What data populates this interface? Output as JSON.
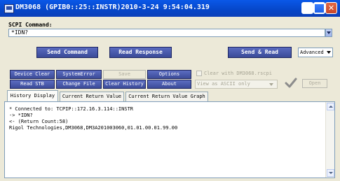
{
  "window": {
    "title": "DM3068 (GPIB0::25::INSTR)2010-3-24 9:54:04.319"
  },
  "scpi": {
    "label": "SCPI Command:",
    "value": "*IDN?"
  },
  "main_buttons": {
    "send_command": "Send Command",
    "read_response": "Read Response",
    "send_read": "Send & Read",
    "advanced": "Advanced"
  },
  "tool_buttons": {
    "device_clear": "Device Clear",
    "system_error": "SystemError",
    "save": "Save",
    "options": "Options",
    "read_stb": "Read STB",
    "change_file": "Change File",
    "clear_history": "Clear History",
    "about": "About",
    "open": "Open"
  },
  "options_area": {
    "clear_checkbox_label": "Clear with DM3068.rscpi",
    "view_select_value": "View as ASCII only"
  },
  "tabs": [
    {
      "label": "History Display",
      "active": true
    },
    {
      "label": "Current Return Value",
      "active": false
    },
    {
      "label": "Current Return Value Graph",
      "active": false
    }
  ],
  "history": {
    "lines": [
      "* Connected to: TCPIP::172.16.3.114::INSTR",
      "-> *IDN?",
      "<- (Return Count:58)",
      "Rigol Technologies,DM3068,DM3A201003060,01.01.00.01.99.00"
    ]
  },
  "colors": {
    "titlebar": "#0646c8",
    "button": "#3a4a98"
  }
}
